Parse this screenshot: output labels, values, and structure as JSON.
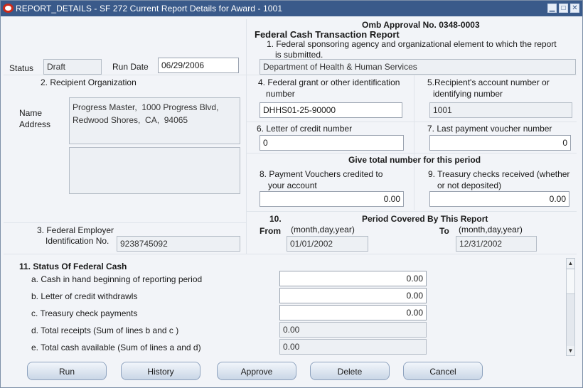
{
  "window": {
    "title": "REPORT_DETAILS -     SF 272 Current Report Details for Award - 1001",
    "minimize": "▁",
    "maximize": "□",
    "close": "✕"
  },
  "header": {
    "omb": "Omb Approval No. 0348-0003",
    "report_title": "Federal Cash Transaction Report",
    "item1_line1": "1. Federal sponsoring agency and organizational element to which the report",
    "item1_line2": "is submitted.",
    "agency": "Department of Health & Human Services",
    "status_label": "Status",
    "status_value": "Draft",
    "run_date_label": "Run Date",
    "run_date_value": "06/29/2006"
  },
  "recipient": {
    "heading": "2. Recipient Organization",
    "name_label": "Name",
    "address_label": "Address",
    "name_address": "Progress Master,  1000 Progress Blvd,\nRedwood Shores,  CA,  94065",
    "extra": ""
  },
  "grant": {
    "item4_line1": "4. Federal grant or other identification",
    "item4_line2": "number",
    "item4_value": "DHHS01-25-90000",
    "item5_line1": "5.Recipient's account number or",
    "item5_line2": "identifying number",
    "item5_value": "1001",
    "item6_label": "6. Letter of credit number",
    "item6_value": "0",
    "item7_label": "7. Last payment voucher number",
    "item7_value": "0",
    "give_total": "Give total number for this period",
    "item8_line1": "8. Payment Vouchers credited to",
    "item8_line2": "your account",
    "item8_value": "0.00",
    "item9_line1": "9. Treasury checks received (whether",
    "item9_line2": "or not deposited)",
    "item9_value": "0.00"
  },
  "employer": {
    "line1": "3. Federal Employer",
    "line2": "Identification No.",
    "value": "9238745092"
  },
  "period": {
    "number": "10.",
    "title": "Period Covered By This Report",
    "from_label": "From",
    "from_hint": "(month,day,year)",
    "from_value": "01/01/2002",
    "to_label": "To",
    "to_hint": "(month,day,year)",
    "to_value": "12/31/2002"
  },
  "status_cash": {
    "heading": "11. Status Of Federal Cash",
    "rows": [
      {
        "label": "a. Cash in hand beginning of reporting period",
        "value": "0.00"
      },
      {
        "label": "b. Letter of credit withdrawls",
        "value": "0.00"
      },
      {
        "label": "c. Treasury check payments",
        "value": "0.00"
      },
      {
        "label": "d. Total receipts (Sum of lines b and c )",
        "value": "0.00"
      },
      {
        "label": "e. Total cash available (Sum of lines a and d)",
        "value": "0.00"
      }
    ]
  },
  "buttons": {
    "run": "Run",
    "history": "History",
    "approve": "Approve",
    "delete": "Delete",
    "cancel": "Cancel"
  }
}
